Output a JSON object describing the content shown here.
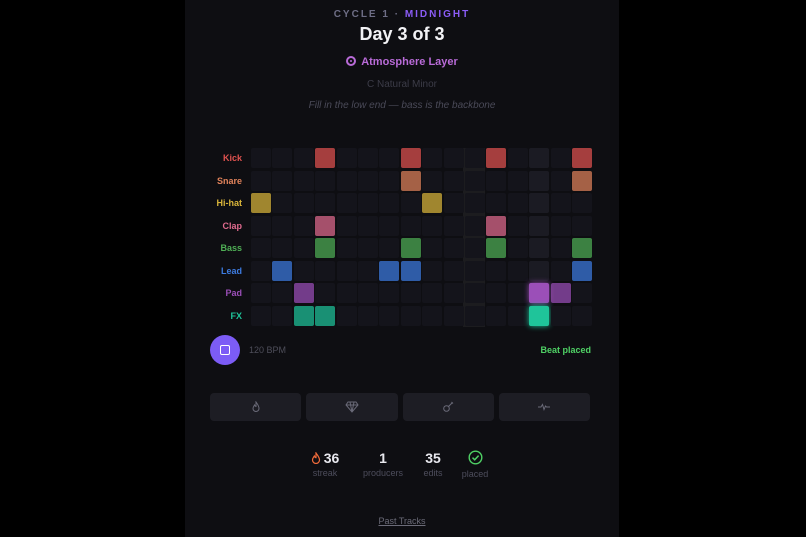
{
  "header": {
    "cycle_prefix": "CYCLE 1 · ",
    "cycle_name": "MIDNIGHT",
    "day": "Day 3 of 3",
    "layer": "Atmosphere Layer",
    "scale": "C Natural Minor",
    "hint": "Fill in the low end — bass is the backbone"
  },
  "sequencer": {
    "steps": 16,
    "playhead_step": 13,
    "tracks": [
      {
        "label": "Kick",
        "color": "#e0524f",
        "active": [
          3,
          7,
          11,
          15
        ]
      },
      {
        "label": "Snare",
        "color": "#e0825a",
        "active": [
          7,
          15
        ]
      },
      {
        "label": "Hi-hat",
        "color": "#d9b53a",
        "active": [
          0,
          8
        ]
      },
      {
        "label": "Clap",
        "color": "#e06b8e",
        "active": [
          3,
          11
        ]
      },
      {
        "label": "Bass",
        "color": "#4fae55",
        "active": [
          3,
          7,
          11,
          15
        ]
      },
      {
        "label": "Lead",
        "color": "#3d7be0",
        "active": [
          1,
          6,
          7,
          15
        ]
      },
      {
        "label": "Pad",
        "color": "#9b4fb8",
        "active": [
          2,
          13,
          14
        ]
      },
      {
        "label": "FX",
        "color": "#1fc49a",
        "active": [
          2,
          3,
          13
        ]
      }
    ]
  },
  "transport": {
    "bpm": "120 BPM",
    "status": "Beat placed"
  },
  "toolbar": {
    "icons": [
      "flame-icon",
      "gem-icon",
      "guitar-icon",
      "wave-icon"
    ]
  },
  "stats": {
    "streak": {
      "value": "36",
      "label": "streak"
    },
    "producers": {
      "value": "1",
      "label": "producers"
    },
    "edits": {
      "value": "35",
      "label": "edits"
    },
    "placed": {
      "label": "placed"
    }
  },
  "footer": {
    "past_tracks": "Past Tracks"
  },
  "colors": {
    "accent": "#7c5cf6",
    "success": "#4fd165",
    "streak": "#ef6a3a"
  }
}
